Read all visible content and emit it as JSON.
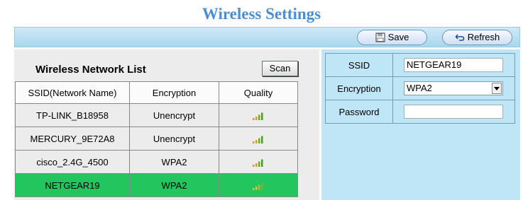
{
  "page": {
    "title": "Wireless Settings"
  },
  "toolbar": {
    "save_label": "Save",
    "refresh_label": "Refresh"
  },
  "list": {
    "title": "Wireless Network List",
    "scan_label": "Scan",
    "columns": [
      "SSID(Network Name)",
      "Encryption",
      "Quality"
    ],
    "rows": [
      {
        "ssid": "TP-LINK_B18958",
        "encryption": "Unencrypt",
        "quality_icon": "signal-strength-icon"
      },
      {
        "ssid": "MERCURY_9E72A8",
        "encryption": "Unencrypt",
        "quality_icon": "signal-strength-icon"
      },
      {
        "ssid": "cisco_2.4G_4500",
        "encryption": "WPA2",
        "quality_icon": "signal-strength-icon"
      },
      {
        "ssid": "NETGEAR19",
        "encryption": "WPA2",
        "quality_icon": "signal-strength-icon",
        "selected": true
      }
    ]
  },
  "form": {
    "ssid_label": "SSID",
    "ssid_value": "NETGEAR19",
    "encryption_label": "Encryption",
    "encryption_value": "WPA2",
    "password_label": "Password",
    "password_value": ""
  },
  "colors": {
    "title": "#4a8fd6",
    "toolbar": "#bfe6f6",
    "selected_row": "#22c55e",
    "list_bg": "#ececec",
    "form_bg": "#bfe6f6"
  }
}
